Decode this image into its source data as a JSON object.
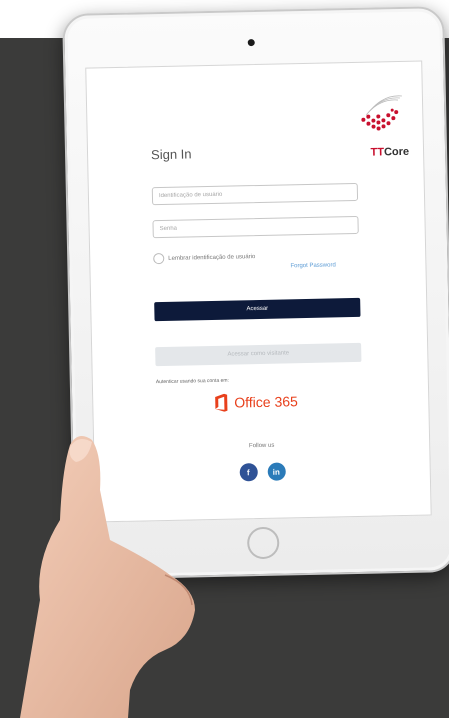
{
  "login": {
    "title": "Sign In",
    "brand": {
      "prefix": "TT",
      "name": "Core"
    },
    "username_placeholder": "Identificação de usuário",
    "password_placeholder": "Senha",
    "remember_label": "Lembrar identificação de usuário",
    "forgot_link": "Forgot Password",
    "primary_button": "Acessar",
    "secondary_button": "Acessar como visitante",
    "auth_label": "Autenticar usando sua conta em:",
    "office_label": "Office 365",
    "follow_label": "Follow us",
    "social": [
      {
        "icon": "facebook-icon",
        "glyph": "f"
      },
      {
        "icon": "linkedin-icon",
        "glyph": "in"
      }
    ]
  },
  "colors": {
    "primary_button": "#0d1a3a",
    "office": "#e8401c",
    "brand_red": "#c8102e",
    "facebook": "#2f5296",
    "linkedin": "#2b7bb9"
  }
}
